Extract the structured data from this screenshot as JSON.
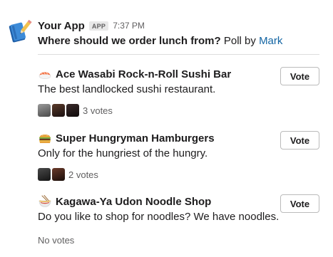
{
  "message": {
    "app_name": "Your App",
    "app_badge": "APP",
    "timestamp": "7:37 PM",
    "question": "Where should we order lunch from?",
    "poll_by_label": "Poll by",
    "author": "Mark"
  },
  "options": [
    {
      "emoji": "sushi-icon",
      "title": "Ace Wasabi Rock-n-Roll Sushi Bar",
      "description": "The best landlocked sushi restaurant.",
      "vote_label": "Vote",
      "voter_count": 3,
      "votes_text": "3 votes"
    },
    {
      "emoji": "hamburger-icon",
      "title": "Super Hungryman Hamburgers",
      "description": "Only for the hungriest of the hungry.",
      "vote_label": "Vote",
      "voter_count": 2,
      "votes_text": "2 votes"
    },
    {
      "emoji": "ramen-icon",
      "title": "Kagawa-Ya Udon Noodle Shop",
      "description": "Do you like to shop for noodles? We have noodles.",
      "vote_label": "Vote",
      "voter_count": 0,
      "votes_text": "No votes"
    }
  ],
  "colors": {
    "link": "#1264a3",
    "muted": "#616061",
    "text": "#1d1c1d",
    "divider": "#dddddd"
  }
}
